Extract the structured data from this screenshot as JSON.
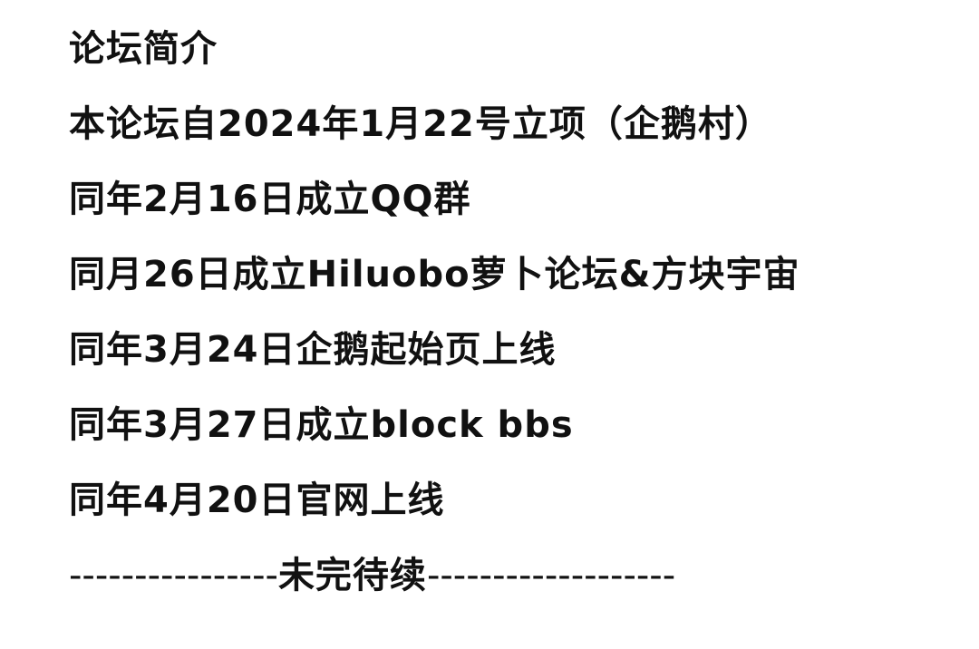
{
  "title": "论坛简介",
  "lines": [
    "本论坛自2024年1月22号立项（企鹅村）",
    "同年2月16日成立QQ群",
    "同月26日成立Hiluobo萝卜论坛&方块宇宙",
    "同年3月24日企鹅起始页上线",
    "同年3月27日成立block bbs",
    "同年4月20日官网上线"
  ],
  "divider": {
    "left": "----------------",
    "center": "未完待续",
    "right": "-------------------"
  }
}
